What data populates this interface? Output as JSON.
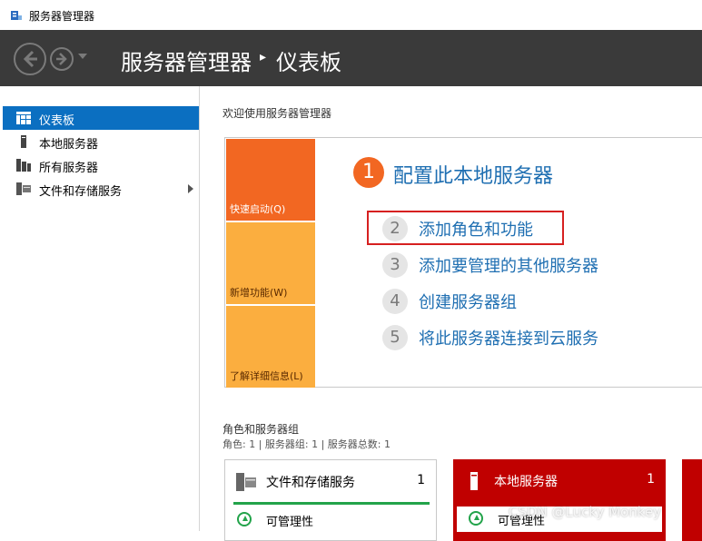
{
  "window": {
    "title": "服务器管理器"
  },
  "header": {
    "breadcrumb_root": "服务器管理器",
    "separator": "▸",
    "current": "仪表板"
  },
  "sidebar": {
    "items": [
      {
        "label": "仪表板",
        "icon": "dashboard-icon",
        "active": true
      },
      {
        "label": "本地服务器",
        "icon": "server-icon"
      },
      {
        "label": "所有服务器",
        "icon": "servers-icon"
      },
      {
        "label": "文件和存储服务",
        "icon": "file-storage-icon",
        "has_submenu": true
      }
    ]
  },
  "welcome": {
    "title": "欢迎使用服务器管理器",
    "tiles": [
      "快速启动(Q)",
      "新增功能(W)",
      "了解详细信息(L)"
    ],
    "main_step": {
      "number": "1",
      "label": "配置此本地服务器"
    },
    "steps": [
      {
        "number": "2",
        "label": "添加角色和功能"
      },
      {
        "number": "3",
        "label": "添加要管理的其他服务器"
      },
      {
        "number": "4",
        "label": "创建服务器组"
      },
      {
        "number": "5",
        "label": "将此服务器连接到云服务"
      }
    ]
  },
  "roles": {
    "title": "角色和服务器组",
    "counts": "角色: 1 | 服务器组: 1 | 服务器总数: 1",
    "cards": [
      {
        "name": "文件和存储服务",
        "count": "1",
        "status": "可管理性"
      },
      {
        "name": "本地服务器",
        "count": "1",
        "status": "可管理性"
      }
    ]
  },
  "watermark": "CSDN @Lucky Monkey",
  "colors": {
    "header_bg": "#3a3a3a",
    "accent_blue": "#0b6fc1",
    "orange": "#f26722",
    "light_orange": "#fbae3f",
    "red": "#c00000",
    "green": "#22a34a",
    "highlight_red": "#d62020"
  }
}
